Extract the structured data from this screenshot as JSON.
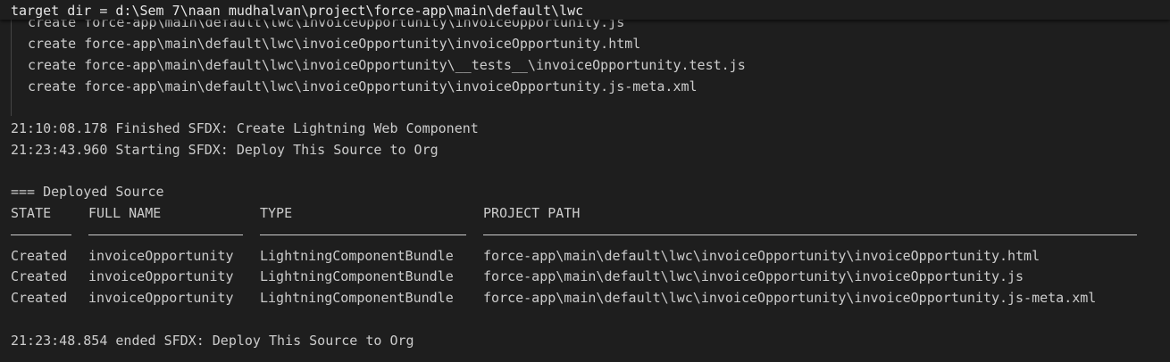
{
  "sticky_header": "target dir = d:\\Sem 7\\naan mudhalvan\\project\\force-app\\main\\default\\lwc",
  "create_lines": [
    "create force-app\\main\\default\\lwc\\invoiceOpportunity\\invoiceOpportunity.js",
    "create force-app\\main\\default\\lwc\\invoiceOpportunity\\invoiceOpportunity.html",
    "create force-app\\main\\default\\lwc\\invoiceOpportunity\\__tests__\\invoiceOpportunity.test.js",
    "create force-app\\main\\default\\lwc\\invoiceOpportunity\\invoiceOpportunity.js-meta.xml"
  ],
  "log_finished": "21:10:08.178 Finished SFDX: Create Lightning Web Component",
  "log_starting": "21:23:43.960 Starting SFDX: Deploy This Source to Org",
  "section_title": "=== Deployed Source",
  "table": {
    "headers": [
      "STATE",
      "FULL NAME",
      "TYPE",
      "PROJECT PATH"
    ],
    "rows": [
      [
        "Created",
        "invoiceOpportunity",
        "LightningComponentBundle",
        "force-app\\main\\default\\lwc\\invoiceOpportunity\\invoiceOpportunity.html"
      ],
      [
        "Created",
        "invoiceOpportunity",
        "LightningComponentBundle",
        "force-app\\main\\default\\lwc\\invoiceOpportunity\\invoiceOpportunity.js"
      ],
      [
        "Created",
        "invoiceOpportunity",
        "LightningComponentBundle",
        "force-app\\main\\default\\lwc\\invoiceOpportunity\\invoiceOpportunity.js-meta.xml"
      ]
    ]
  },
  "log_ended": "21:23:48.854 ended SFDX: Deploy This Source to Org",
  "colors": {
    "background": "#1e1e1e",
    "text": "#cccccc"
  }
}
